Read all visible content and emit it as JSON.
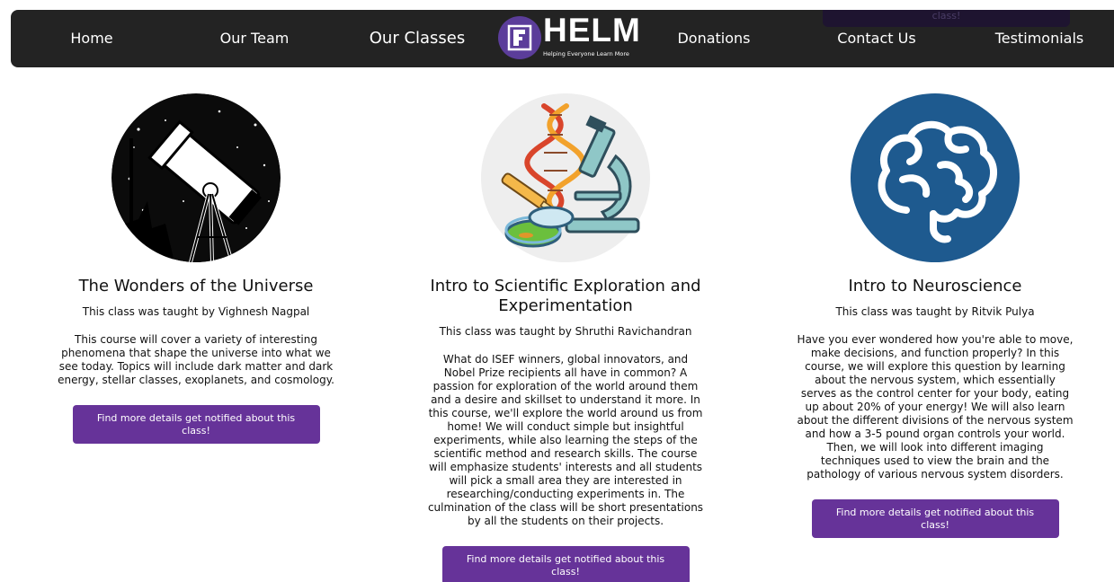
{
  "nav": {
    "items": [
      {
        "label": "Home"
      },
      {
        "label": "Our Team"
      },
      {
        "label": "Our Classes"
      },
      {
        "label": "Donations"
      },
      {
        "label": "Contact Us"
      },
      {
        "label": "Testimonials"
      }
    ],
    "active_item": "Our Classes",
    "logo": {
      "wordmark": "HELM",
      "tagline": "Helping Everyone Learn More"
    },
    "overlap_button_fragment": "class!"
  },
  "classes": [
    {
      "title": "The Wonders of the Universe",
      "teacher": "This class was taught by Vighnesh Nagpal",
      "description": "This course will cover a variety of interesting phenomena that shape the universe into what we see today. Topics will include dark matter and dark energy, stellar classes, exoplanets, and cosmology.",
      "button_label": "Find more details get notified about this class!",
      "icon": "telescope-icon"
    },
    {
      "title": "Intro to Scientific Exploration and Experimentation",
      "teacher": "This class was taught by Shruthi Ravichandran",
      "description": "What do ISEF winners, global innovators, and Nobel Prize recipients all have in common? A passion for exploration of the world around them and a desire and skillset to understand it more. In this course, we'll explore the world around us from home! We will conduct simple but insightful experiments, while also learning the steps of the scientific method and research skills. The course will emphasize students' interests and all students will pick a small area they are interested in researching/conducting experiments in. The culmination of the class will be short presentations by all the students on their projects.",
      "button_label": "Find more details get notified about this class!",
      "icon": "microscope-dna-icon"
    },
    {
      "title": "Intro to Neuroscience",
      "teacher": "This class was taught by Ritvik Pulya",
      "description": "Have you ever wondered how you're able to move, make decisions, and function properly? In this course, we will explore this question by learning about the nervous system, which essentially serves as the control center for your body, eating up about 20% of your energy! We will also learn about the different divisions of the nervous system and how a 3-5 pound organ controls your world. Then, we will look into different imaging techniques used to view the brain and the pathology of various nervous system disorders.",
      "button_label": "Find more details get notified about this class!",
      "icon": "brain-icon"
    }
  ],
  "colors": {
    "navbar_bg": "#232323",
    "accent_purple": "#663399",
    "logo_purple": "#5b3d9a",
    "neuro_blue": "#1e5a8f"
  }
}
